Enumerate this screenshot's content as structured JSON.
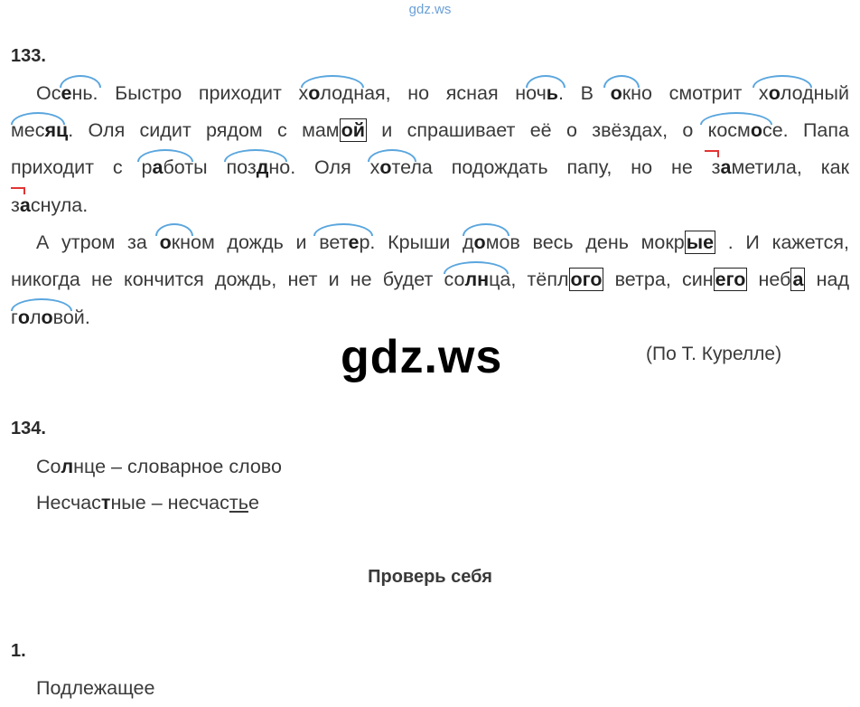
{
  "watermark_top": "gdz.ws",
  "watermark_big": "gdz.ws",
  "task133": {
    "number": "133.",
    "lines": [
      [
        "Ос",
        "е",
        "нь. Быстро приходит х",
        "о",
        "лодная, но ясная ноч",
        "ь",
        ". В ",
        "о",
        "кно смотрит х",
        "о",
        "лодный"
      ],
      [
        "мес",
        "яц",
        ". Оля сидит рядом с мам",
        "ой",
        " и спрашивает её о звёздах, о косм",
        "о",
        "се. Папа"
      ],
      [
        "приходит с р",
        "а",
        "боты поз",
        "д",
        "но. Оля х",
        "о",
        "тела подождать папу, но не з",
        "а",
        "метила, как"
      ],
      [
        "з",
        "а",
        "снула."
      ],
      [
        "А утром за ",
        "о",
        "кном дождь и вет",
        "е",
        "р. Крыши д",
        "о",
        "мов весь день мокр",
        "ые",
        " . И кажется,"
      ],
      [
        "никогда не кончится дождь, нет и не будет со",
        "лн",
        "ца, тёпл",
        "ого",
        " ветра, син",
        "его",
        " неб",
        "а",
        " над"
      ],
      [
        "г",
        "о",
        "л",
        "о",
        "вой."
      ]
    ],
    "author": "(По Т. Курелле)"
  },
  "task134": {
    "number": "134.",
    "line1": [
      "Со",
      "л",
      "нце – словарное слово"
    ],
    "line2": [
      "Несчас",
      "т",
      "ные – несчас",
      "ть",
      "е"
    ]
  },
  "check": {
    "heading": "Проверь себя"
  },
  "task1": {
    "number": "1.",
    "text": "Подлежащее"
  },
  "colors": {
    "arc": "#5aa6de",
    "red_mark": "#e23434",
    "text": "#3a3a3a"
  }
}
